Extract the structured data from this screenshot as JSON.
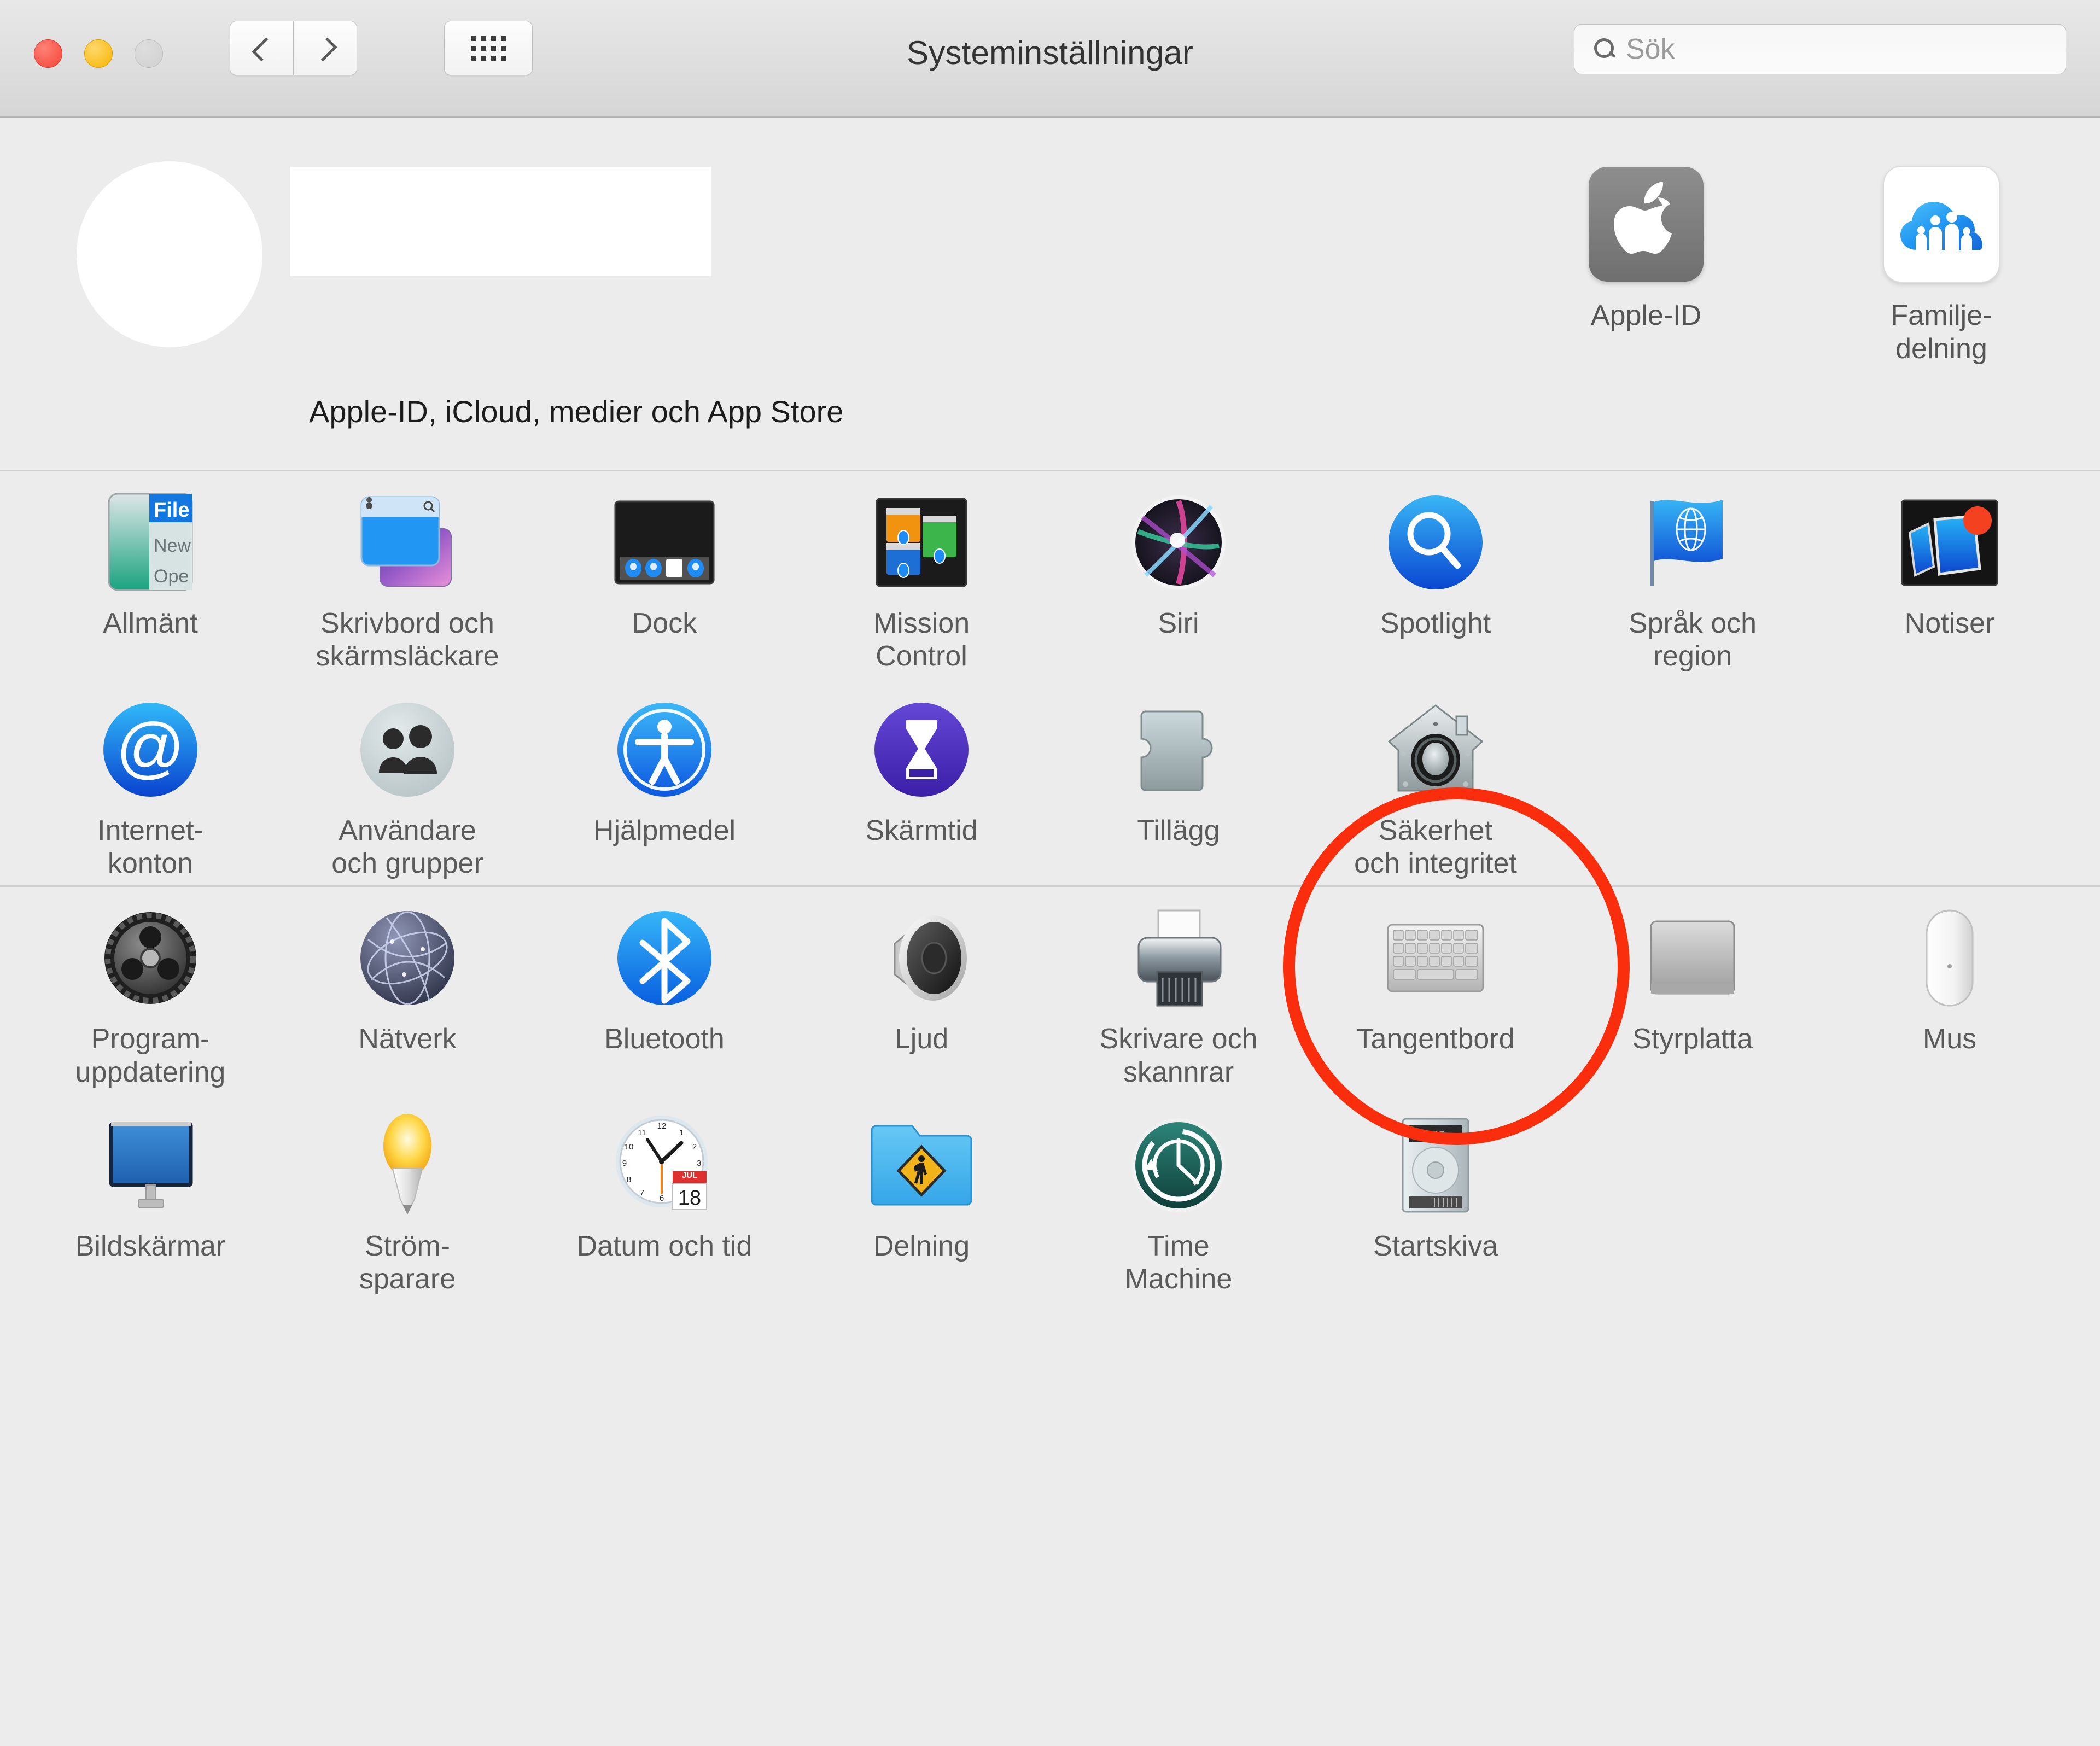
{
  "window": {
    "title": "Systeminställningar",
    "traffic_lights": [
      "close",
      "minimize",
      "maximize"
    ],
    "nav": {
      "back_label": "Tillbaka",
      "forward_label": "Framåt",
      "grid_label": "Visa alla"
    },
    "search": {
      "placeholder": "Sök",
      "value": ""
    }
  },
  "account": {
    "subtitle": "Apple-ID, iCloud, medier och App Store",
    "name_redacted": true,
    "avatar_redacted": true,
    "tiles": [
      {
        "label": "Apple-ID",
        "icon": "apple-logo-icon"
      },
      {
        "label": "Familje-\ndelning",
        "label_line1": "Familje-",
        "label_line2": "delning",
        "icon": "family-cloud-icon"
      }
    ]
  },
  "annotation": {
    "type": "ellipse-highlight",
    "target": "Säkerhet och integritet",
    "color": "#fa2d0c"
  },
  "sections": [
    {
      "id": "personal",
      "rows": [
        [
          {
            "label_line1": "Allmänt",
            "label_line2": "",
            "icon": "general-icon"
          },
          {
            "label_line1": "Skrivbord och",
            "label_line2": "skärmsläckare",
            "icon": "desktop-screensaver-icon"
          },
          {
            "label_line1": "Dock",
            "label_line2": "",
            "icon": "dock-icon"
          },
          {
            "label_line1": "Mission",
            "label_line2": "Control",
            "icon": "mission-control-icon"
          },
          {
            "label_line1": "Siri",
            "label_line2": "",
            "icon": "siri-icon"
          },
          {
            "label_line1": "Spotlight",
            "label_line2": "",
            "icon": "spotlight-icon"
          },
          {
            "label_line1": "Språk och",
            "label_line2": "region",
            "icon": "language-region-icon"
          },
          {
            "label_line1": "Notiser",
            "label_line2": "",
            "icon": "notifications-icon"
          }
        ],
        [
          {
            "label_line1": "Internet-",
            "label_line2": "konton",
            "icon": "internet-accounts-icon"
          },
          {
            "label_line1": "Användare",
            "label_line2": "och grupper",
            "icon": "users-groups-icon"
          },
          {
            "label_line1": "Hjälpmedel",
            "label_line2": "",
            "icon": "accessibility-icon"
          },
          {
            "label_line1": "Skärmtid",
            "label_line2": "",
            "icon": "screen-time-icon"
          },
          {
            "label_line1": "Tillägg",
            "label_line2": "",
            "icon": "extensions-icon"
          },
          {
            "label_line1": "Säkerhet",
            "label_line2": "och integritet",
            "icon": "security-privacy-icon",
            "highlighted": true
          },
          {
            "label_line1": "",
            "label_line2": "",
            "icon": ""
          },
          {
            "label_line1": "",
            "label_line2": "",
            "icon": ""
          }
        ]
      ]
    },
    {
      "id": "hardware",
      "rows": [
        [
          {
            "label_line1": "Program-",
            "label_line2": "uppdatering",
            "icon": "software-update-icon"
          },
          {
            "label_line1": "Nätverk",
            "label_line2": "",
            "icon": "network-icon"
          },
          {
            "label_line1": "Bluetooth",
            "label_line2": "",
            "icon": "bluetooth-icon"
          },
          {
            "label_line1": "Ljud",
            "label_line2": "",
            "icon": "sound-icon"
          },
          {
            "label_line1": "Skrivare och",
            "label_line2": "skannrar",
            "icon": "printers-scanners-icon"
          },
          {
            "label_line1": "Tangentbord",
            "label_line2": "",
            "icon": "keyboard-icon"
          },
          {
            "label_line1": "Styrplatta",
            "label_line2": "",
            "icon": "trackpad-icon"
          },
          {
            "label_line1": "Mus",
            "label_line2": "",
            "icon": "mouse-icon"
          }
        ],
        [
          {
            "label_line1": "Bildskärmar",
            "label_line2": "",
            "icon": "displays-icon"
          },
          {
            "label_line1": "Ström-",
            "label_line2": "sparare",
            "icon": "energy-saver-icon"
          },
          {
            "label_line1": "Datum och tid",
            "label_line2": "",
            "icon": "date-time-icon"
          },
          {
            "label_line1": "Delning",
            "label_line2": "",
            "icon": "sharing-icon"
          },
          {
            "label_line1": "Time",
            "label_line2": "Machine",
            "icon": "time-machine-icon"
          },
          {
            "label_line1": "Startskiva",
            "label_line2": "",
            "icon": "startup-disk-icon"
          },
          {
            "label_line1": "",
            "label_line2": "",
            "icon": ""
          },
          {
            "label_line1": "",
            "label_line2": "",
            "icon": ""
          }
        ]
      ]
    }
  ],
  "colors": {
    "window_bg": "#ececec",
    "titlebar_top": "#e8e8e8",
    "titlebar_bottom": "#d6d6d6",
    "label_text": "#5a5a5a",
    "title_text": "#333333",
    "annotation_red": "#fa2d0c",
    "accent_blue": "#1277e0"
  }
}
